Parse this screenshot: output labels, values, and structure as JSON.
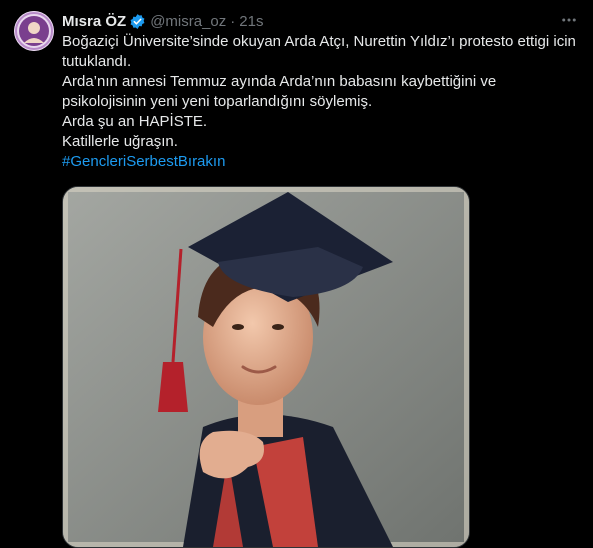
{
  "author": {
    "name": "Mısra ÖZ",
    "handle": "@misra_oz",
    "separator": "·",
    "time": "21s",
    "verified_icon": "verified-badge-icon"
  },
  "tweet": {
    "lines": [
      "Boğaziçi Üniversite’sinde okuyan Arda Atçı,  Nurettin Yıldız’ı protesto ettigi icin tutuklandı.",
      "Arda’nın annesi Temmuz ayında Arda’nın babasını kaybettiğini ve psikolojisinin yeni yeni toparlandığını söylemiş.",
      "Arda şu an HAPİSTE.",
      "Katillerle uğraşın."
    ],
    "hashtag": "#GencleriSerbestBırakın"
  },
  "colors": {
    "background": "#000000",
    "text": "#e7e9ea",
    "secondary": "#71767b",
    "link": "#1d9bf0"
  }
}
